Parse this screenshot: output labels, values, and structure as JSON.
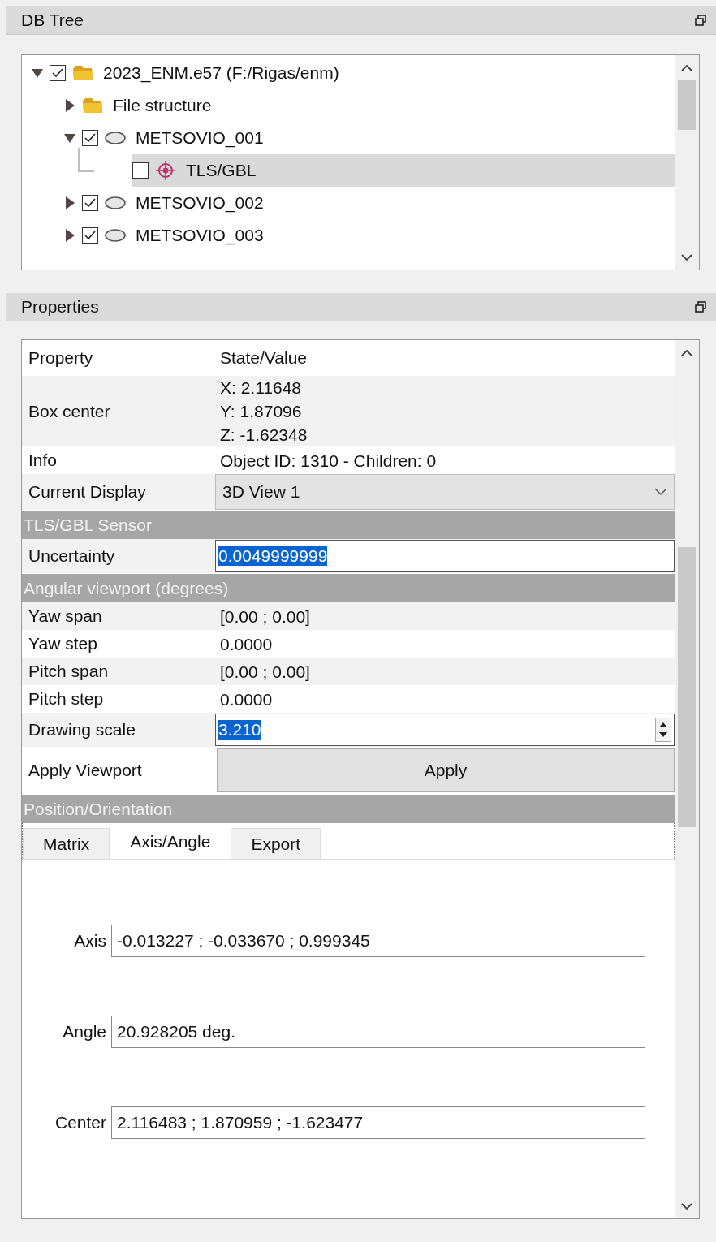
{
  "db_tree": {
    "title": "DB Tree",
    "items": [
      {
        "label": "2023_ENM.e57 (F:/Rigas/enm)",
        "kind": "folder",
        "checked": true,
        "expanded": true,
        "selected": false,
        "children": [
          {
            "label": "File structure",
            "kind": "folder",
            "expanded": false,
            "selected": false
          },
          {
            "label": "METSOVIO_001",
            "kind": "cloud",
            "checked": true,
            "expanded": true,
            "selected": false,
            "children": [
              {
                "label": "TLS/GBL",
                "kind": "sensor",
                "checked": false,
                "selected": true
              }
            ]
          },
          {
            "label": "METSOVIO_002",
            "kind": "cloud",
            "checked": true,
            "expanded": false,
            "selected": false
          },
          {
            "label": "METSOVIO_003",
            "kind": "cloud",
            "checked": true,
            "expanded": false,
            "selected": false
          }
        ]
      }
    ]
  },
  "properties": {
    "title": "Properties",
    "columns": [
      "Property",
      "State/Value"
    ],
    "rows": [
      {
        "kind": "text",
        "name": "Box center",
        "value": [
          "X: 2.11648",
          "Y: 1.87096",
          "Z: -1.62348"
        ]
      },
      {
        "kind": "text",
        "name": "Info",
        "value": [
          "Object ID: 1310 - Children: 0"
        ]
      },
      {
        "kind": "combo",
        "name": "Current Display",
        "value": "3D View 1"
      },
      {
        "kind": "section",
        "name": "TLS/GBL Sensor"
      },
      {
        "kind": "input",
        "name": "Uncertainty",
        "value": "0.0049999999",
        "text_selected": true
      },
      {
        "kind": "section",
        "name": "Angular viewport (degrees)"
      },
      {
        "kind": "text",
        "name": "Yaw span",
        "value": [
          "[0.00 ; 0.00]"
        ]
      },
      {
        "kind": "text",
        "name": "Yaw step",
        "value": [
          "0.0000"
        ]
      },
      {
        "kind": "text",
        "name": "Pitch span",
        "value": [
          "[0.00 ; 0.00]"
        ]
      },
      {
        "kind": "text",
        "name": "Pitch step",
        "value": [
          "0.0000"
        ]
      },
      {
        "kind": "spin",
        "name": "Drawing scale",
        "value": "3.210",
        "text_selected": true
      },
      {
        "kind": "button",
        "name": "Apply Viewport",
        "value": "Apply"
      },
      {
        "kind": "section",
        "name": "Position/Orientation"
      }
    ],
    "tabs": [
      {
        "label": "Matrix",
        "selected": false
      },
      {
        "label": "Axis/Angle",
        "selected": true
      },
      {
        "label": "Export",
        "selected": false
      }
    ],
    "fields": [
      {
        "label": "Axis",
        "value": "-0.013227 ; -0.033670 ; 0.999345"
      },
      {
        "label": "Angle",
        "value": "20.928205 deg."
      },
      {
        "label": "Center",
        "value": "2.116483 ; 1.870959 ; -1.623477"
      }
    ]
  }
}
